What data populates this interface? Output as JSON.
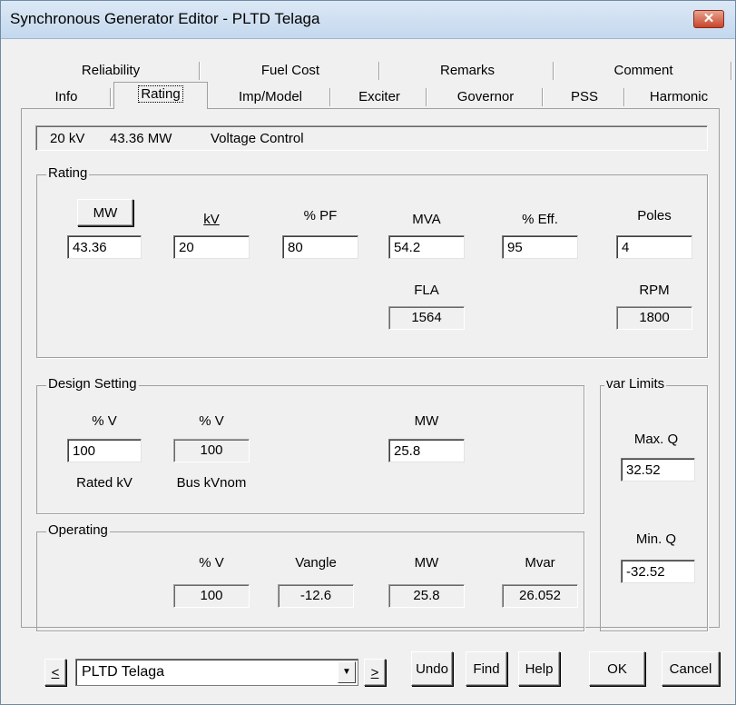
{
  "window": {
    "title": "Synchronous Generator Editor - PLTD Telaga",
    "close": "✕"
  },
  "tabs_row1": [
    "Reliability",
    "Fuel Cost",
    "Remarks",
    "Comment"
  ],
  "tabs_row2": [
    "Info",
    "Rating",
    "Imp/Model",
    "Exciter",
    "Governor",
    "PSS",
    "Harmonic"
  ],
  "summary": {
    "kv": "20 kV",
    "mw": "43.36 MW",
    "mode": "Voltage Control"
  },
  "rating": {
    "title": "Rating",
    "mw_button": "MW",
    "kv_label": "kV",
    "pf_label": "% PF",
    "mva_label": "MVA",
    "eff_label": "% Eff.",
    "poles_label": "Poles",
    "mw_value": "43.36",
    "kv_value": "20",
    "pf_value": "80",
    "mva_value": "54.2",
    "eff_value": "95",
    "poles_value": "4",
    "fla_label": "FLA",
    "fla_value": "1564",
    "rpm_label": "RPM",
    "rpm_value": "1800"
  },
  "design": {
    "title": "Design Setting",
    "v_label": "% V",
    "v_value": "100",
    "v_caption": "Rated kV",
    "busv_label": "% V",
    "busv_value": "100",
    "busv_caption": "Bus kVnom",
    "mw_label": "MW",
    "mw_value": "25.8"
  },
  "var_limits": {
    "title": "var Limits",
    "max_label": "Max. Q",
    "max_value": "32.52",
    "min_label": "Min. Q",
    "min_value": "-32.52"
  },
  "operating": {
    "title": "Operating",
    "v_label": "% V",
    "v_value": "100",
    "vangle_label": "Vangle",
    "vangle_value": "-12.6",
    "mw_label": "MW",
    "mw_value": "25.8",
    "mvar_label": "Mvar",
    "mvar_value": "26.052"
  },
  "footer": {
    "prev": "<",
    "next": ">",
    "element": "PLTD Telaga",
    "undo": "Undo",
    "find": "Find",
    "help": "Help",
    "ok": "OK",
    "cancel": "Cancel"
  }
}
